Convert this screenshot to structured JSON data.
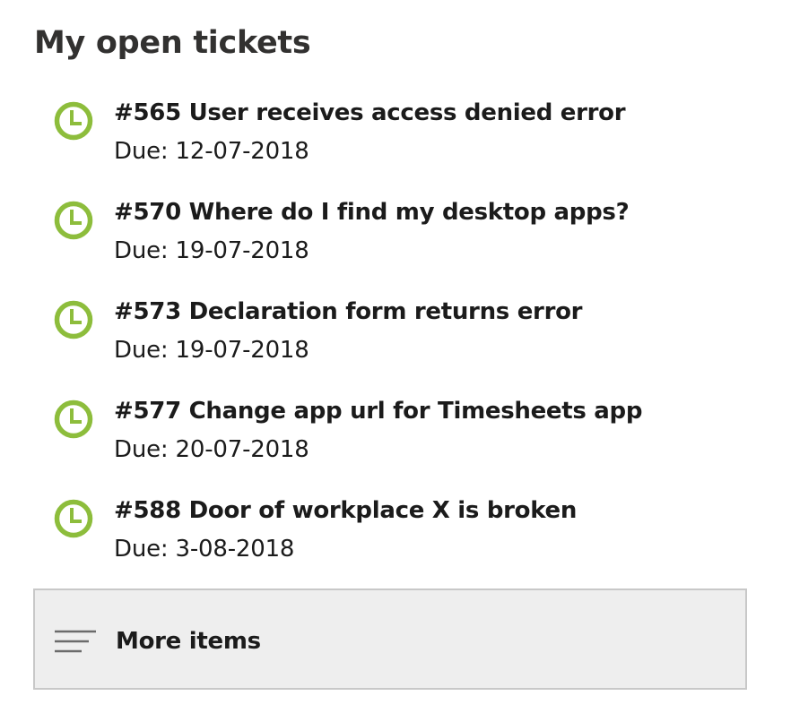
{
  "widget": {
    "title": "My open tickets",
    "accent_color": "#8dbd3c",
    "ticket_icon": "clock-icon",
    "tickets": [
      {
        "title": "#565 User receives access denied error",
        "due": "Due: 12-07-2018"
      },
      {
        "title": "#570 Where do I find my desktop apps?",
        "due": "Due: 19-07-2018"
      },
      {
        "title": "#573 Declaration form returns error",
        "due": "Due: 19-07-2018"
      },
      {
        "title": "#577 Change app url for Timesheets app",
        "due": "Due: 20-07-2018"
      },
      {
        "title": "#588 Door of workplace X is broken",
        "due": "Due: 3-08-2018"
      }
    ],
    "more_items": {
      "label": "More items",
      "icon": "menu-lines-icon"
    }
  }
}
